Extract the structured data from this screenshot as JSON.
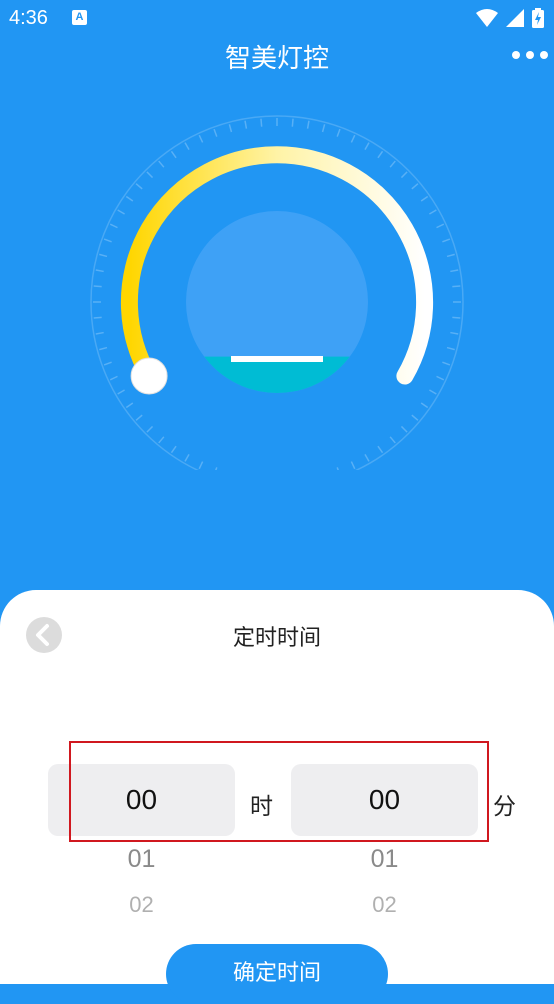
{
  "status_bar": {
    "time": "4:36",
    "app_icon_letter": "A"
  },
  "header": {
    "title": "智美灯控"
  },
  "colors": {
    "primary": "#2196F3",
    "arc_start": "#FFD600",
    "arc_end": "#FFFFFF",
    "water": "#00BCD4"
  },
  "dial": {
    "level_fraction": 0.2
  },
  "timer_sheet": {
    "title": "定时时间",
    "hour_value": "00",
    "hour_unit": "时",
    "minute_value": "00",
    "minute_unit": "分",
    "hour_options": [
      "01",
      "02"
    ],
    "minute_options": [
      "01",
      "02"
    ],
    "confirm_label": "确定时间"
  }
}
